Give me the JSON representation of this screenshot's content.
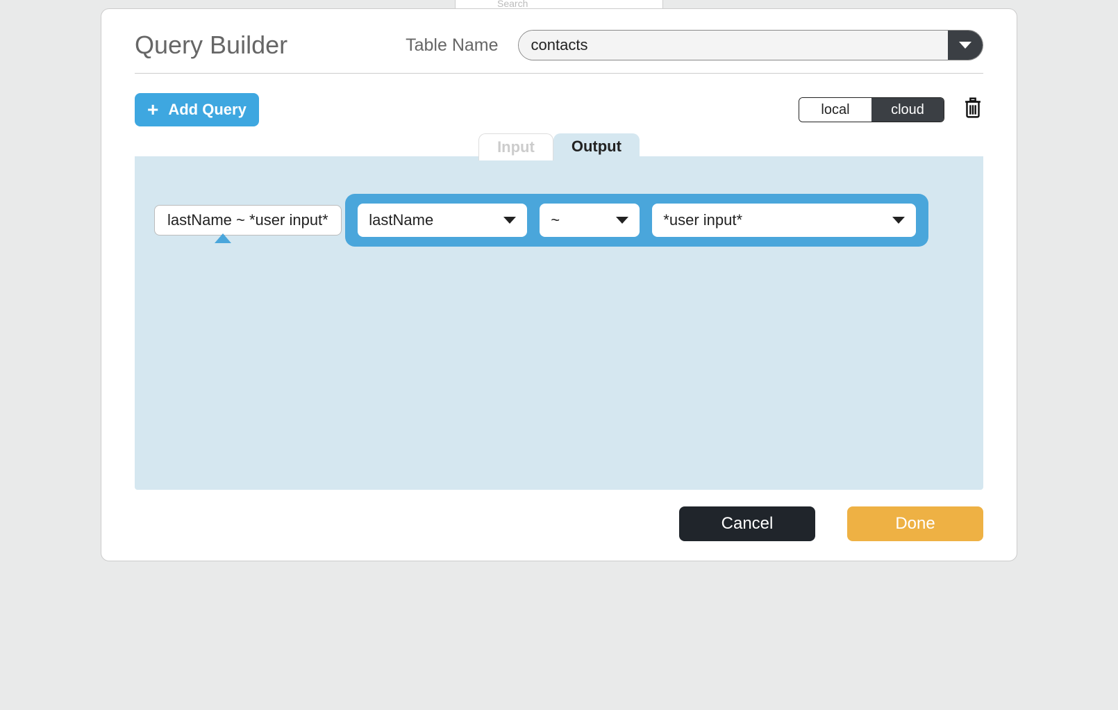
{
  "backdrop": {
    "search_placeholder": "Search"
  },
  "dialog": {
    "title": "Query Builder",
    "table_name_label": "Table Name",
    "table_select": {
      "value": "contacts"
    }
  },
  "toolbar": {
    "add_query_label": "Add Query",
    "segmented": {
      "local": "local",
      "cloud": "cloud",
      "active": "cloud"
    }
  },
  "tabs": {
    "input": "Input",
    "output": "Output",
    "active": "Output"
  },
  "canvas": {
    "chip_label": "lastName ~ *user input*",
    "row": {
      "field": "lastName",
      "operator": "~",
      "value": "*user input*"
    }
  },
  "footer": {
    "cancel": "Cancel",
    "done": "Done"
  }
}
